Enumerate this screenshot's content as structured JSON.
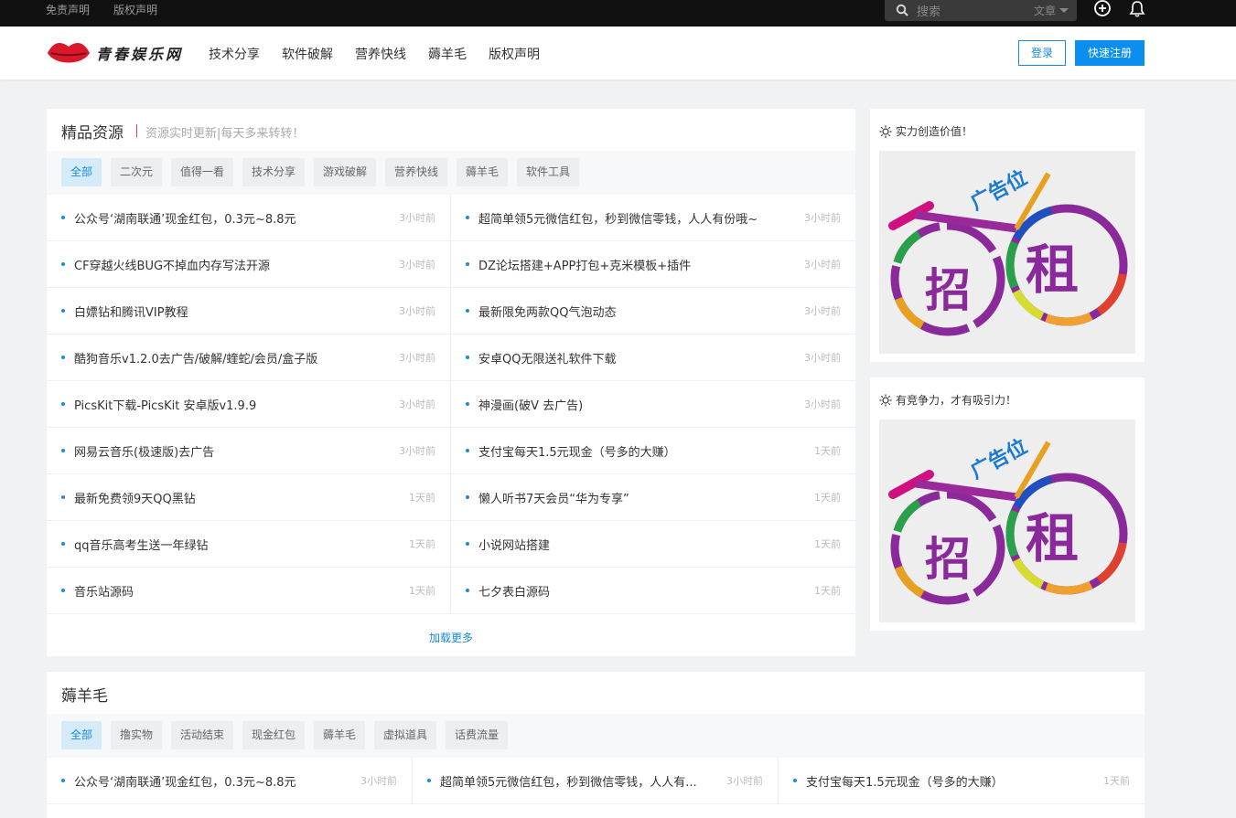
{
  "topbar": {
    "links": [
      "免责声明",
      "版权声明"
    ],
    "search_placeholder": "搜索",
    "search_category": "文章",
    "add_icon": "plus-circle-icon",
    "bell_icon": "bell-icon"
  },
  "header": {
    "logo_text": "青春娱乐网",
    "nav": [
      "技术分享",
      "软件破解",
      "营养快线",
      "薅羊毛",
      "版权声明"
    ],
    "login_label": "登录",
    "register_label": "快速注册"
  },
  "colors": {
    "accent": "#0a8ff0",
    "link": "#1a8bd6",
    "topbar": "#111111",
    "logo_lips": "#d9182b"
  },
  "main": {
    "title": "精品资源",
    "subtitle": "资源实时更新|每天多来转转！",
    "tabs": [
      "全部",
      "二次元",
      "值得一看",
      "技术分享",
      "游戏破解",
      "营养快线",
      "薅羊毛",
      "软件工具"
    ],
    "rows": [
      {
        "left": {
          "title": "公众号‘湖南联通’现金红包，0.3元~8.8元",
          "time": "3小时前"
        },
        "right": {
          "title": "超简单领5元微信红包，秒到微信零钱，人人有份哦~",
          "time": "3小时前"
        }
      },
      {
        "left": {
          "title": "CF穿越火线BUG不掉血内存写法开源",
          "time": "3小时前"
        },
        "right": {
          "title": "DZ论坛搭建+APP打包+克米模板+插件",
          "time": "3小时前"
        }
      },
      {
        "left": {
          "title": "白嫖钻和腾讯VIP教程",
          "time": "3小时前"
        },
        "right": {
          "title": "最新限免两款QQ气泡动态",
          "time": "3小时前"
        }
      },
      {
        "left": {
          "title": "酷狗音乐v1.2.0去广告/破解/蝰蛇/会员/盒子版",
          "time": "3小时前"
        },
        "right": {
          "title": "安卓QQ无限送礼软件下载",
          "time": "3小时前"
        }
      },
      {
        "left": {
          "title": "PicsKit下载-PicsKit 安卓版v1.9.9",
          "time": "3小时前"
        },
        "right": {
          "title": "神漫画(破V 去广告)",
          "time": "3小时前"
        }
      },
      {
        "left": {
          "title": "网易云音乐(极速版)去广告",
          "time": "3小时前"
        },
        "right": {
          "title": "支付宝每天1.5元现金（号多的大赚）",
          "time": "1天前"
        }
      },
      {
        "left": {
          "title": "最新免费领9天QQ黑钻",
          "time": "1天前"
        },
        "right": {
          "title": "懒人听书7天会员“华为专享”",
          "time": "1天前"
        }
      },
      {
        "left": {
          "title": "qq音乐高考生送一年绿钻",
          "time": "1天前"
        },
        "right": {
          "title": "小说网站搭建",
          "time": "1天前"
        }
      },
      {
        "left": {
          "title": "音乐站源码",
          "time": "1天前"
        },
        "right": {
          "title": "七夕表白源码",
          "time": "1天前"
        }
      }
    ],
    "load_more": "加载更多"
  },
  "ads": [
    {
      "heading": "实力创造价值！",
      "text_top": "广告位",
      "text_left": "招",
      "text_right": "租"
    },
    {
      "heading": "有竞争力，才有吸引力！",
      "text_top": "广告位",
      "text_left": "招",
      "text_right": "租"
    }
  ],
  "second": {
    "title": "薅羊毛",
    "tabs": [
      "全部",
      "撸实物",
      "活动结束",
      "现金红包",
      "薅羊毛",
      "虚拟道具",
      "话费流量"
    ],
    "rows": [
      {
        "title": "公众号‘湖南联通’现金红包，0.3元~8.8元",
        "time": "3小时前"
      },
      {
        "title": "超简单领5元微信红包，秒到微信零钱，人人有...",
        "time": "3小时前"
      },
      {
        "title": "支付宝每天1.5元现金（号多的大赚）",
        "time": "1天前"
      }
    ]
  }
}
